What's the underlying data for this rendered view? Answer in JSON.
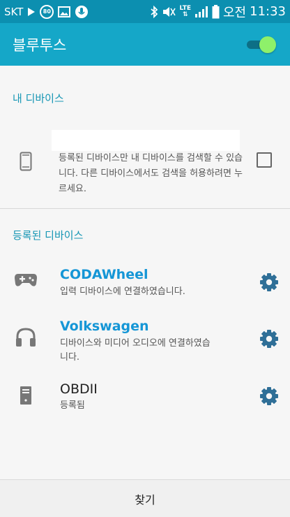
{
  "status_bar": {
    "carrier": "SKT",
    "badge": "80",
    "network": "LTE",
    "ampm": "오전",
    "time": "11:33"
  },
  "app_bar": {
    "title": "블루투스",
    "toggle_on": true
  },
  "my_device": {
    "header": "내 디바이스",
    "description": "등록된 디바이스만 내 디바이스를 검색할 수 있습니다. 다른 디바이스에서도 검색을 허용하려면 누르세요.",
    "checked": false
  },
  "registered": {
    "header": "등록된 디바이스",
    "devices": [
      {
        "name": "CODAWheel",
        "status": "입력 디바이스에 연결하였습니다.",
        "icon": "gamepad-icon"
      },
      {
        "name": "Volkswagen",
        "status": "디바이스와 미디어 오디오에 연결하였습니다.",
        "icon": "headphones-icon"
      },
      {
        "name": "OBDII",
        "status": "등록됨",
        "icon": "device-box-icon"
      }
    ]
  },
  "bottom": {
    "find_label": "찾기"
  },
  "colors": {
    "status_bar": "#0c8fb0",
    "app_bar": "#15a7c8",
    "accent": "#1596d6",
    "toggle_thumb": "#8ef06a",
    "gear": "#2f6f97"
  }
}
